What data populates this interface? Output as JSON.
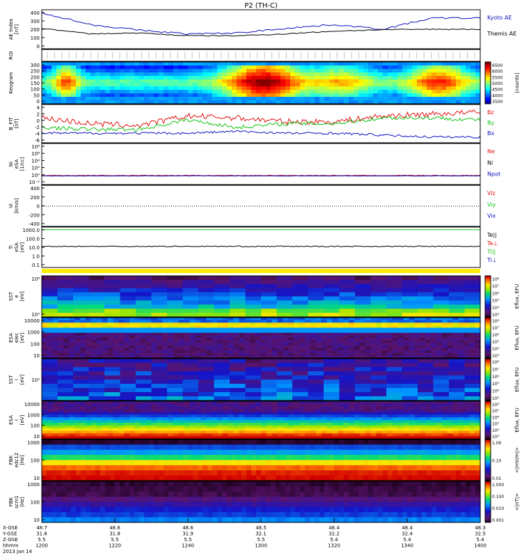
{
  "title": "P2 (TH-C)",
  "date_label": "2013 Jan 14",
  "colors": {
    "red": "#e01010",
    "green": "#10c010",
    "blue": "#1010c0",
    "black": "#000000"
  },
  "panels": [
    {
      "id": "ae",
      "ylabel": [
        "AE Index",
        "[nT]"
      ],
      "yticks": [
        "400",
        "300",
        "200",
        "100",
        "0"
      ],
      "legend": [
        {
          "text": "Kyoto AE",
          "color": "#1010c0"
        },
        {
          "text": "Themis AE",
          "color": "#000000"
        }
      ]
    },
    {
      "id": "roi",
      "ylabel": [
        "ROI"
      ],
      "yticks": [],
      "legend": []
    },
    {
      "id": "keogram",
      "ylabel": [
        "Keogram"
      ],
      "yticks": [
        "300",
        "250",
        "200",
        "150",
        "100",
        "50",
        "0"
      ],
      "legend": [],
      "colorbar": {
        "ticks": [
          "6500",
          "6000",
          "5500",
          "5000",
          "4500",
          "4000",
          "3500"
        ],
        "label": "[counts]"
      }
    },
    {
      "id": "bfit",
      "ylabel": [
        "B_FIT",
        "[nT]"
      ],
      "yticks": [
        "4",
        "2",
        "0",
        "-2",
        "-4",
        "-6"
      ],
      "legend": [
        {
          "text": "Bz",
          "color": "#e01010"
        },
        {
          "text": "By",
          "color": "#10c010"
        },
        {
          "text": "Bx",
          "color": "#1010c0"
        }
      ]
    },
    {
      "id": "ni",
      "ylabel": [
        "Ni",
        "eSA",
        "[1/cc]"
      ],
      "yticks": [
        "10⁸",
        "10⁶",
        "10⁴",
        "10²",
        "10⁰",
        "10⁻²"
      ],
      "legend": [
        {
          "text": "Ne",
          "color": "#e01010"
        },
        {
          "text": "Ni",
          "color": "#000000"
        },
        {
          "text": "Npot",
          "color": "#1010c0"
        }
      ]
    },
    {
      "id": "vi",
      "ylabel": [
        "Vi",
        "[km/s]"
      ],
      "yticks": [
        "400",
        "200",
        "0",
        "-200",
        "-400"
      ],
      "legend": [
        {
          "text": "Viz",
          "color": "#e01010"
        },
        {
          "text": "Viy",
          "color": "#10c010"
        },
        {
          "text": "Vix",
          "color": "#1010c0"
        }
      ]
    },
    {
      "id": "ti",
      "ylabel": [
        "Ti",
        "eSA",
        "[eV]"
      ],
      "yticks": [
        "1000.0",
        "100.0",
        "10.0",
        "1.0",
        "0.1"
      ],
      "legend": [
        {
          "text": "Te||",
          "color": "#000000"
        },
        {
          "text": "Te⊥",
          "color": "#e01010"
        },
        {
          "text": "Ti||",
          "color": "#10c010"
        },
        {
          "text": "Ti⊥",
          "color": "#1010c0"
        }
      ]
    },
    {
      "id": "sst_e",
      "ylabel": [
        "SST",
        "e",
        "[eV]"
      ],
      "yticks": [
        "10⁶",
        "10⁵"
      ],
      "legend": [],
      "colorbar": {
        "ticks": [
          "10⁸",
          "10⁷",
          "10⁶",
          "10⁵",
          "10⁴",
          "10³"
        ],
        "label": "Eflux, EFU"
      }
    },
    {
      "id": "esa_e",
      "ylabel": [
        "ESA",
        "elec",
        "[eV]"
      ],
      "yticks": [
        "10000",
        "1000",
        "100",
        "10"
      ],
      "legend": [],
      "colorbar": {
        "ticks": [
          "10⁸",
          "10⁷",
          "10⁶",
          "10⁵",
          "10⁴",
          "10³"
        ],
        "label": "Eflux, EFU"
      }
    },
    {
      "id": "sst_i",
      "ylabel": [
        "SST",
        "i",
        "[eV]"
      ],
      "yticks": [
        "10⁵"
      ],
      "legend": [],
      "colorbar": {
        "ticks": [
          "10⁸",
          "10⁷",
          "10⁶",
          "10⁵",
          "10⁴",
          "10³"
        ],
        "label": "Eflux, EFU"
      }
    },
    {
      "id": "esa_i",
      "ylabel": [
        "ESA",
        "i",
        "[eV]"
      ],
      "yticks": [
        "10000",
        "1000",
        "100",
        "10"
      ],
      "legend": [],
      "colorbar": {
        "ticks": [
          "10⁸",
          "10⁷",
          "10⁶",
          "10⁵",
          "10⁴",
          "10³"
        ],
        "label": "Eflux, EFU"
      }
    },
    {
      "id": "fbk_e",
      "ylabel": [
        "FBK",
        "edc12",
        "[Hz]"
      ],
      "yticks": [
        "1000",
        "100",
        "10"
      ],
      "legend": [],
      "colorbar": {
        "ticks": [
          "1.00",
          "0.10",
          "0.01"
        ],
        "label": "<|mV/m|>"
      }
    },
    {
      "id": "fbk_b",
      "ylabel": [
        "FBK",
        "scm1",
        "[Hz]"
      ],
      "yticks": [
        "1000",
        "100",
        "10"
      ],
      "legend": [],
      "colorbar": {
        "ticks": [
          "1.000",
          "0.100",
          "0.010",
          "0.001"
        ],
        "label": "<|nT|>"
      }
    }
  ],
  "xaxis": {
    "row_labels": [
      "X-GSE",
      "Y-GSE",
      "Z-GSE",
      "hhmm"
    ],
    "ticks": [
      {
        "x": "48.7",
        "y": "31.6",
        "z": "5.5",
        "t": "1200"
      },
      {
        "x": "48.6",
        "y": "31.8",
        "z": "5.5",
        "t": "1220"
      },
      {
        "x": "48.6",
        "y": "31.9",
        "z": "5.5",
        "t": "1240"
      },
      {
        "x": "48.5",
        "y": "32.1",
        "z": "5.5",
        "t": "1300"
      },
      {
        "x": "48.4",
        "y": "32.2",
        "z": "5.4",
        "t": "1320"
      },
      {
        "x": "48.4",
        "y": "32.4",
        "z": "5.4",
        "t": "1340"
      },
      {
        "x": "48.3",
        "y": "32.5",
        "z": "5.4",
        "t": "1400"
      }
    ]
  },
  "chart_data": {
    "type": "line",
    "title": "P2 (TH-C)",
    "x": [
      "1200",
      "1220",
      "1240",
      "1300",
      "1320",
      "1340",
      "1400"
    ],
    "xlabel": "hhmm",
    "series": [
      {
        "name": "Kyoto AE",
        "values": [
          390,
          260,
          200,
          160,
          170,
          220,
          260,
          210,
          330,
          330
        ]
      },
      {
        "name": "Themis AE",
        "values": [
          220,
          160,
          170,
          140,
          140,
          160,
          190,
          205,
          210,
          210
        ]
      },
      {
        "name": "Bz",
        "values": [
          0.5,
          -1.0,
          -1.5,
          1.0,
          0.5,
          -0.5,
          -0.5,
          1.0,
          1.5,
          2.0
        ]
      },
      {
        "name": "By",
        "values": [
          -2.0,
          -2.5,
          -2.5,
          0.0,
          -2.0,
          -1.0,
          -1.0,
          0.5,
          0.5,
          0.0
        ]
      },
      {
        "name": "Bx",
        "values": [
          -3.5,
          -3.5,
          -3.5,
          -3.5,
          -3.0,
          -3.5,
          -3.5,
          -4.0,
          -4.5,
          -4.5
        ]
      }
    ],
    "ylim": [
      0,
      400
    ]
  }
}
